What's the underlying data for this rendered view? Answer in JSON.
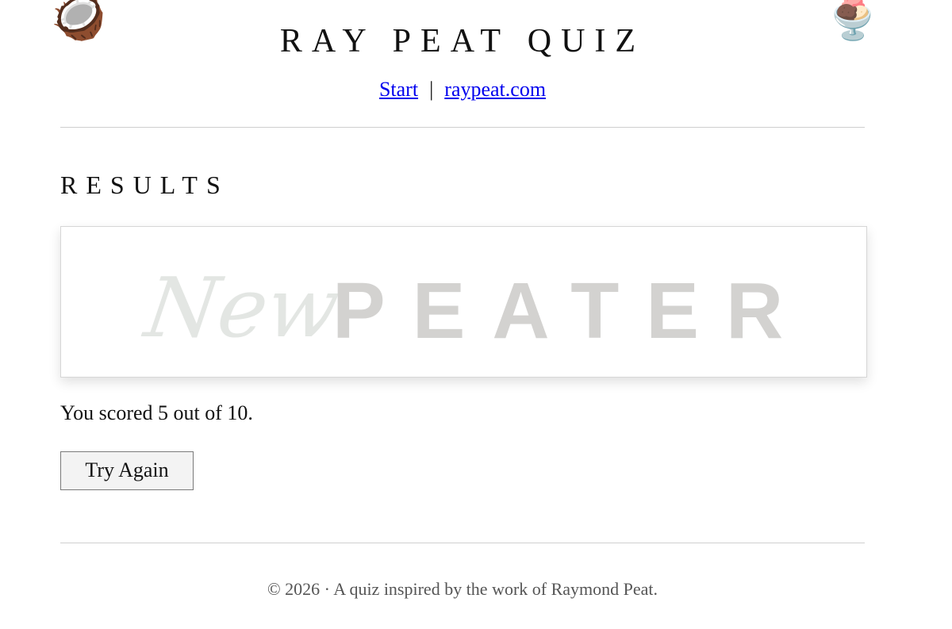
{
  "header": {
    "title": "RAY PEAT QUIZ",
    "left_icon": "coconut-icon",
    "right_icon": "ice-cream-sundae-icon",
    "left_glyph": "🥥",
    "right_glyph": "🍨"
  },
  "nav": {
    "start_label": "Start",
    "separator": "|",
    "site_label": "raypeat.com"
  },
  "results": {
    "heading": "RESULTS",
    "banner": {
      "script_word": "New",
      "block_word": "PEATER",
      "script_color": "#e3e6e3",
      "block_color": "#d3d2d0"
    },
    "score_text": "You scored 5 out of 10.",
    "try_again_label": "Try Again"
  },
  "footer": {
    "text": "© 2026 · A quiz inspired by the work of Raymond Peat."
  },
  "colors": {
    "link": "#0000ee",
    "rule": "#cfcfcf",
    "footer_text": "#555555"
  }
}
